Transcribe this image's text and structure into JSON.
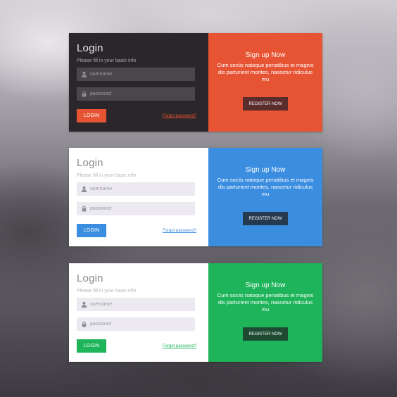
{
  "cards": [
    {
      "theme": "dark",
      "accent": "#e65434",
      "register_button_color": "#5a2c2c",
      "login": {
        "title": "Login",
        "subtitle": "Please fill in your basic info",
        "username_placeholder": "username",
        "password_placeholder": "password",
        "login_button": "LOGIN",
        "forgot_link": "Forgot  password?"
      },
      "signup": {
        "title": "Sign up Now",
        "text": "Cum sociis natoque penatibus et magnis dis parturient montes, nascetur ridiculus mu",
        "register_button": "REGISTER NOW"
      }
    },
    {
      "theme": "light",
      "accent": "#3b8de0",
      "register_button_color": "#253a4f",
      "login": {
        "title": "Login",
        "subtitle": "Please fill in your basic info",
        "username_placeholder": "username",
        "password_placeholder": "password",
        "login_button": "LOGIN",
        "forgot_link": "Forgot  password?"
      },
      "signup": {
        "title": "Sign up Now",
        "text": "Cum sociis natoque penatibus et magnis dis parturient montes, nascetur ridiculus mu",
        "register_button": "REGISTER NOW"
      }
    },
    {
      "theme": "light",
      "accent": "#1eb45a",
      "register_button_color": "#1d4a31",
      "login": {
        "title": "Login",
        "subtitle": "Please fill in your basic info",
        "username_placeholder": "username",
        "password_placeholder": "password",
        "login_button": "LOGIN",
        "forgot_link": "Forgot  password?"
      },
      "signup": {
        "title": "Sign up Now",
        "text": "Cum sociis natoque penatibus et magnis dis parturient montes, nascetur ridiculus mu",
        "register_button": "REGISTER NOW"
      }
    }
  ],
  "icons": {
    "username_icon": "user-icon",
    "password_icon": "lock-icon"
  }
}
